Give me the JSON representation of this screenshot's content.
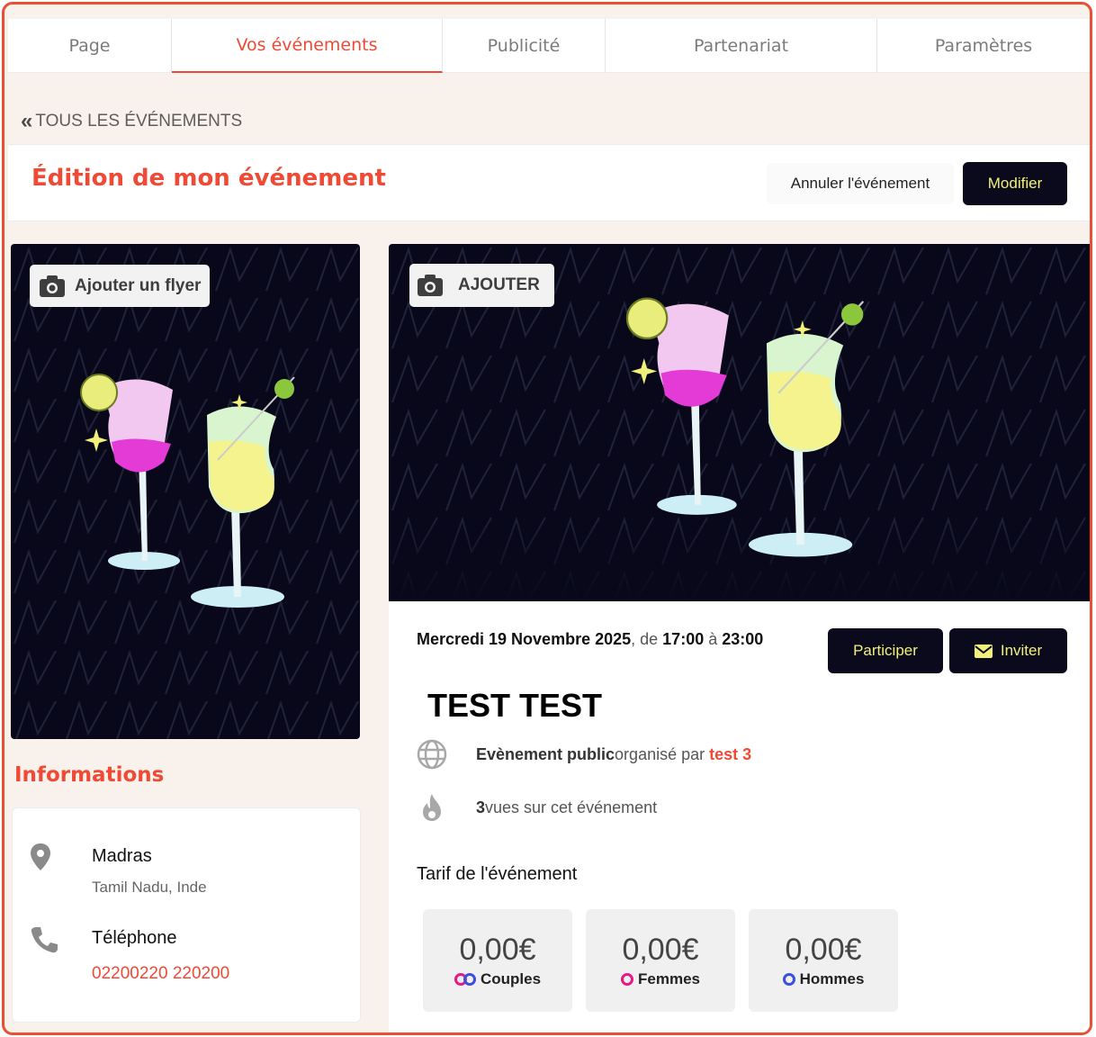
{
  "tabs": [
    {
      "label": "Page",
      "active": false
    },
    {
      "label": "Vos événements",
      "active": true
    },
    {
      "label": "Publicité",
      "active": false
    },
    {
      "label": "Partenariat",
      "active": false
    },
    {
      "label": "Paramètres",
      "active": false
    }
  ],
  "back_link": {
    "label": "TOUS LES ÉVÉNEMENTS",
    "icon": "double-chevron-left-icon"
  },
  "header": {
    "title": "Édition de mon événement",
    "cancel_label": "Annuler l'événement",
    "modify_label": "Modifier"
  },
  "flyer": {
    "add_label": "Ajouter un flyer",
    "icon": "camera-icon"
  },
  "cover": {
    "add_label": "AJOUTER",
    "icon": "camera-icon"
  },
  "info": {
    "title": "Informations",
    "location_name": "Madras",
    "location_detail": "Tamil Nadu, Inde",
    "phone_label": "Téléphone",
    "phone_value": "02200220 220200"
  },
  "event": {
    "date": "Mercredi 19 Novembre 2025",
    "date_sep": ", de ",
    "start": "17:00",
    "to": " à ",
    "end": "23:00",
    "participate_label": "Participer",
    "invite_label": "Inviter",
    "title": "TEST TEST",
    "visibility": "Evènement public",
    "organized_by": " organisé par ",
    "organizer": "test 3",
    "views_count": "3",
    "views_text": " vues sur cet événement",
    "tarif_label": "Tarif de l'événement"
  },
  "prices": [
    {
      "amount": "0,00€",
      "label": "Couples"
    },
    {
      "amount": "0,00€",
      "label": "Femmes"
    },
    {
      "amount": "0,00€",
      "label": "Hommes"
    }
  ],
  "colors": {
    "accent": "#ef4a35",
    "dark": "#0b0a1c",
    "button_text": "#f1f07a",
    "couples": "#cc1fb0",
    "femmes": "#e8178a",
    "hommes": "#3b4fe0"
  }
}
